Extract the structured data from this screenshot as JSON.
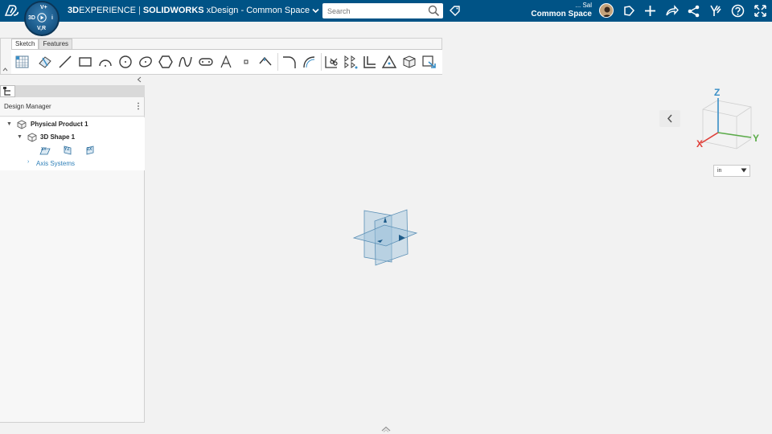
{
  "topbar": {
    "brand_3d": "3D",
    "brand_experience": "EXPERIENCE",
    "brand_sep": "|",
    "brand_solidworks": "SOLIDWORKS",
    "app_name": "xDesign - Common Space",
    "search_placeholder": "Search",
    "user_name": "... Sal",
    "user_space": "Common Space",
    "compass_labels": {
      "top": "V+",
      "left": "3D",
      "right": "i",
      "bottom": "V,R"
    },
    "icons": [
      "tag-icon",
      "share-arrow-icon",
      "add-icon",
      "forward-icon",
      "network-share-icon",
      "community-icon",
      "help-icon",
      "fullscreen-icon"
    ],
    "brand_color": "#005386"
  },
  "ribbon": {
    "tabs": [
      {
        "label": "Sketch",
        "active": true
      },
      {
        "label": "Features",
        "active": false
      }
    ],
    "tools": [
      "sketch-grid-icon",
      "sketch-plane-icon",
      "line-icon",
      "rectangle-icon",
      "arc-icon",
      "circle-icon",
      "ellipse-icon",
      "polygon-icon",
      "spline-icon",
      "slot-icon",
      "text-icon",
      "point-icon",
      "construction-icon",
      "fillet-icon",
      "offset-curve-icon",
      "trim-icon",
      "pattern-icon",
      "offset-icon",
      "constraint-icon",
      "3d-box-icon",
      "exit-sketch-icon"
    ]
  },
  "panel": {
    "title": "Design Manager",
    "tree": {
      "root": "Physical Product 1",
      "shape": "3D Shape 1",
      "planes": [
        "XY",
        "YZ",
        "ZX"
      ],
      "axis_systems": "Axis Systems"
    }
  },
  "viewport": {
    "triad": {
      "z": "Z",
      "x": "X",
      "y": "Y"
    },
    "units": "in",
    "axis_colors": {
      "x": "#e0403a",
      "y": "#5aab48",
      "z": "#3a8fc7"
    }
  }
}
